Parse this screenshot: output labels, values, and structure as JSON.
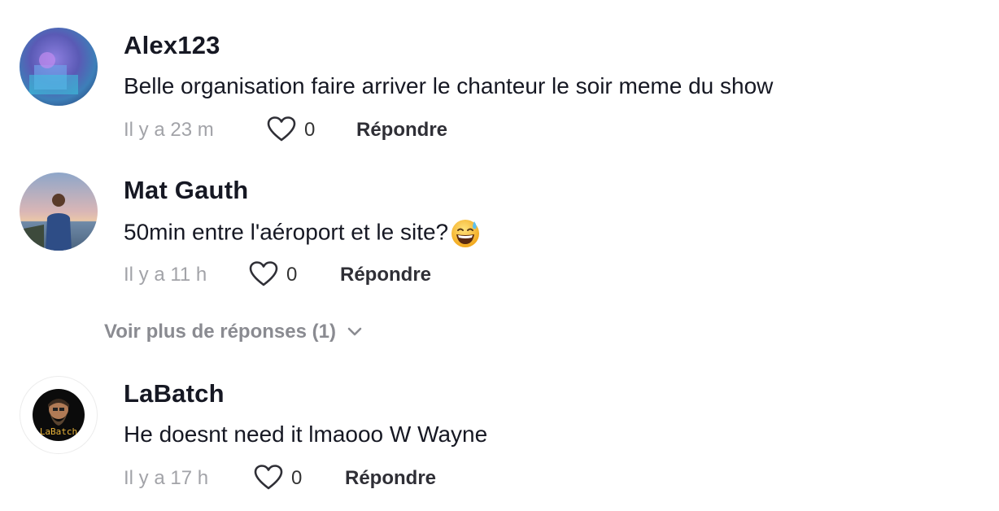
{
  "comments": [
    {
      "username": "Alex123",
      "text": "Belle organisation faire arriver le chanteur le soir meme du show",
      "time": "Il y a 23 m",
      "likes": "0",
      "reply_label": "Répondre",
      "avatar_icon": "photo-avatar-icon"
    },
    {
      "username": "Mat Gauth",
      "text": "50min entre l'aéroport et le site?",
      "emoji": "grinning-sweat-emoji",
      "time": "Il y a 11 h",
      "likes": "0",
      "reply_label": "Répondre",
      "avatar_icon": "photo-avatar-icon"
    },
    {
      "username": "LaBatch",
      "text": "He doesnt need it lmaooo W Wayne",
      "time": "Il y a 17 h",
      "likes": "0",
      "reply_label": "Répondre",
      "avatar_icon": "labatch-logo-avatar-icon",
      "avatar_text": "LaBatch"
    }
  ],
  "more_replies": {
    "label": "Voir plus de réponses (1)",
    "icon": "chevron-down-icon"
  },
  "colors": {
    "username": "#161823",
    "meta": "#a2a3a8",
    "more_replies": "#8a8b91",
    "avatar_text": "#e8b339"
  }
}
